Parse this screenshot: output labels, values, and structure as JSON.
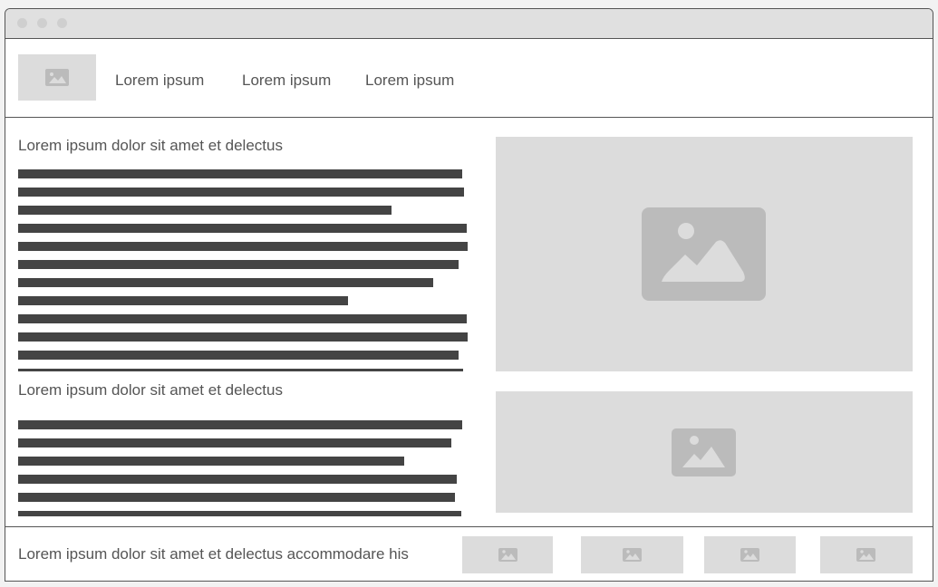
{
  "nav": {
    "items": [
      {
        "label": "Lorem ipsum"
      },
      {
        "label": "Lorem ipsum"
      },
      {
        "label": "Lorem ipsum"
      }
    ]
  },
  "main": {
    "section1": {
      "heading": "Lorem ipsum dolor sit amet et delectus"
    },
    "section2": {
      "heading": "Lorem ipsum dolor sit amet et delectus"
    }
  },
  "footer": {
    "text": "Lorem ipsum dolor sit amet et delectus accommodare his"
  },
  "colors": {
    "placeholder_bg": "#dcdcdc",
    "placeholder_icon": "#bbbbbb",
    "text_bar": "#444444",
    "border": "#555555"
  },
  "icons": {
    "image_placeholder": "image-icon"
  }
}
